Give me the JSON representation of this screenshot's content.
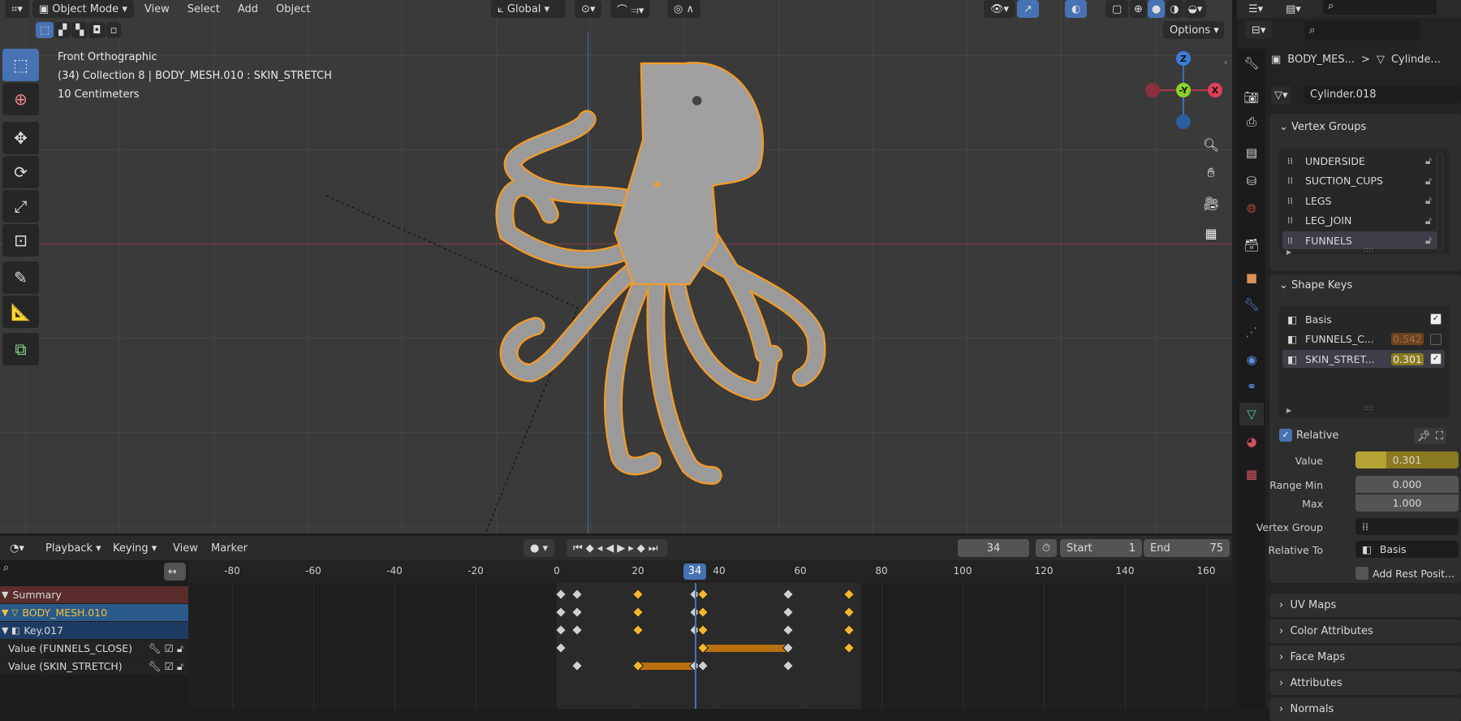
{
  "viewport": {
    "header": {
      "mode": "Object Mode",
      "menus": [
        "View",
        "Select",
        "Add",
        "Object"
      ],
      "orientation": "Global",
      "options": "Options"
    },
    "overlay": {
      "view_name": "Front Orthographic",
      "context": "(34) Collection 8 | BODY_MESH.010 : SKIN_STRETCH",
      "scale": "10 Centimeters"
    },
    "gizmo": {
      "z": "Z",
      "y": "-Y",
      "x": "X"
    },
    "tools": [
      "select-box",
      "cursor",
      "move",
      "rotate",
      "scale",
      "transform",
      "annotate",
      "measure",
      "add-cube"
    ]
  },
  "properties": {
    "breadcrumb": {
      "object": "BODY_MES...",
      "sep": ">",
      "mesh": "Cylinde..."
    },
    "mesh_name": "Cylinder.018",
    "vertex_groups": {
      "title": "Vertex Groups",
      "items": [
        "UNDERSIDE",
        "SUCTION_CUPS",
        "LEGS",
        "LEG_JOIN",
        "FUNNELS"
      ],
      "selected": 4
    },
    "shape_keys": {
      "title": "Shape Keys",
      "items": [
        {
          "name": "Basis",
          "value": "",
          "checked": true
        },
        {
          "name": "FUNNELS_C...",
          "value": "0.542",
          "checked": false
        },
        {
          "name": "SKIN_STRET...",
          "value": "0.301",
          "checked": true
        }
      ],
      "selected": 2,
      "relative_label": "Relative",
      "value_label": "Value",
      "value": "0.301",
      "value_fraction": 0.301,
      "range_min_label": "Range Min",
      "range_min": "0.000",
      "max_label": "Max",
      "max": "1.000",
      "vertex_group_label": "Vertex Group",
      "relative_to_label": "Relative To",
      "relative_to": "Basis",
      "add_rest": "Add Rest Posit..."
    },
    "collapsed_panels": [
      "UV Maps",
      "Color Attributes",
      "Face Maps",
      "Attributes",
      "Normals"
    ]
  },
  "timeline": {
    "menus": [
      "Playback",
      "Keying",
      "View",
      "Marker"
    ],
    "current_frame": "34",
    "start_label": "Start",
    "start": "1",
    "end_label": "End",
    "end": "75",
    "ruler_ticks": [
      "-80",
      "-60",
      "-40",
      "-20",
      "0",
      "20",
      "40",
      "60",
      "80",
      "100",
      "120",
      "140",
      "160"
    ],
    "channels": [
      {
        "name": "Summary",
        "type": "summary"
      },
      {
        "name": "BODY_MESH.010",
        "type": "object"
      },
      {
        "name": "Key.017",
        "type": "key"
      },
      {
        "name": "Value (FUNNELS_CLOSE)",
        "type": "fcurve"
      },
      {
        "name": "Value (SKIN_STRETCH)",
        "type": "fcurve"
      }
    ],
    "keyframes": [
      [
        [
          1,
          "w"
        ],
        [
          5,
          "w"
        ],
        [
          20,
          "y"
        ],
        [
          34,
          "w"
        ],
        [
          36,
          "y"
        ],
        [
          57,
          "w"
        ],
        [
          72,
          "y"
        ]
      ],
      [
        [
          1,
          "w"
        ],
        [
          5,
          "w"
        ],
        [
          20,
          "y"
        ],
        [
          34,
          "w"
        ],
        [
          36,
          "y"
        ],
        [
          57,
          "w"
        ],
        [
          72,
          "y"
        ]
      ],
      [
        [
          1,
          "w"
        ],
        [
          5,
          "w"
        ],
        [
          20,
          "y"
        ],
        [
          34,
          "w"
        ],
        [
          36,
          "y"
        ],
        [
          57,
          "w"
        ],
        [
          72,
          "y"
        ]
      ],
      [
        [
          1,
          "w"
        ],
        [
          36,
          "y"
        ],
        [
          57,
          "w"
        ],
        [
          72,
          "y"
        ]
      ],
      [
        [
          5,
          "w"
        ],
        [
          20,
          "y"
        ],
        [
          34,
          "w"
        ],
        [
          36,
          "w"
        ],
        [
          57,
          "w"
        ]
      ]
    ],
    "holds": [
      [],
      [],
      [],
      [
        [
          36,
          57
        ]
      ],
      [
        [
          20,
          34
        ]
      ]
    ]
  },
  "colors": {
    "accent": "#4772b3",
    "selected_orange": "#f29b28",
    "key_yellow": "#f2b630",
    "hold": "#b8700f"
  }
}
